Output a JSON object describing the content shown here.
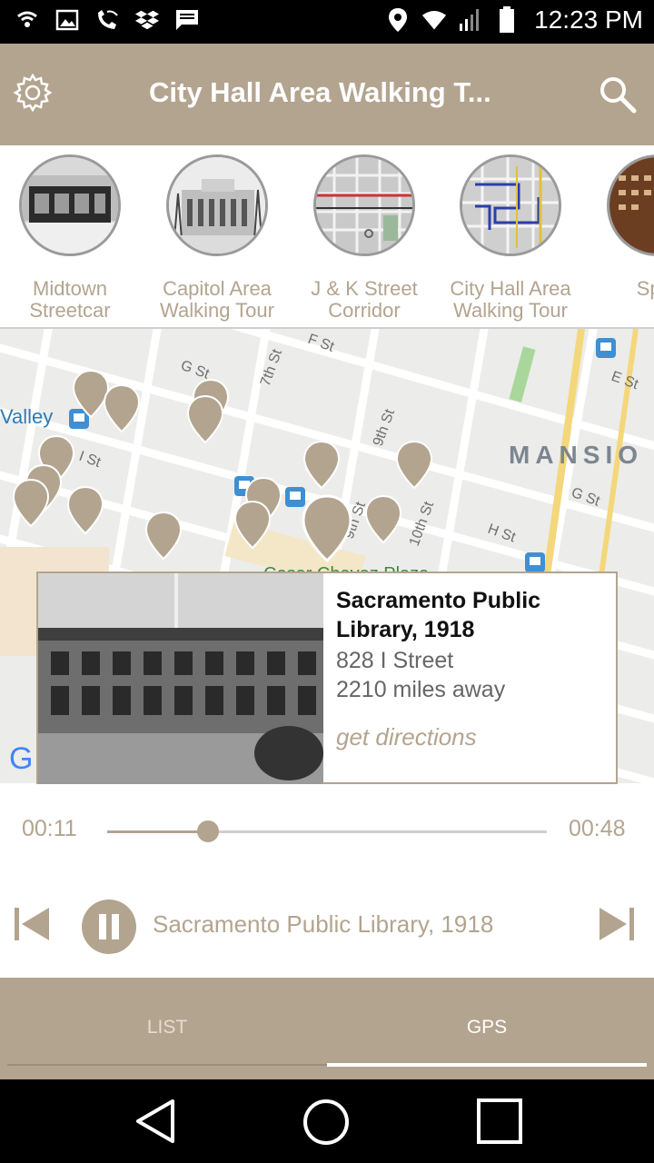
{
  "status_bar": {
    "time": "12:23 PM",
    "icons": [
      "wifi-hotspot-icon",
      "image-icon",
      "wifi-call-icon",
      "dropbox-icon",
      "message-icon",
      "location-icon",
      "wifi-icon",
      "signal-icon",
      "battery-icon"
    ]
  },
  "app_bar": {
    "title": "City Hall Area Walking T...",
    "settings_icon": "gear-icon",
    "search_icon": "search-icon",
    "color": "#b3a48f"
  },
  "tours": [
    {
      "label": "Midtown Streetcar"
    },
    {
      "label": "Capitol Area Walking Tour"
    },
    {
      "label": "J & K Street Corridor"
    },
    {
      "label": "City Hall Area Walking Tour"
    },
    {
      "label": "Spor"
    }
  ],
  "map": {
    "streets": [
      "G St",
      "F St",
      "7th St",
      "E St",
      "I St",
      "9th St",
      "G St",
      "H St",
      "9th St",
      "10th St"
    ],
    "areas": [
      "MANSIO",
      "Valley",
      "Cesar Chavez Plaza"
    ]
  },
  "popup": {
    "title": "Sacramento Public Library, 1918",
    "address": "828 I Street",
    "distance": "2210 miles away",
    "directions": "get directions"
  },
  "player": {
    "elapsed": "00:11",
    "duration": "00:48",
    "progress": 0.23,
    "now_playing": "Sacramento Public Library, 1918"
  },
  "tabs": [
    {
      "label": "LIST",
      "active": false
    },
    {
      "label": "GPS",
      "active": true
    }
  ]
}
